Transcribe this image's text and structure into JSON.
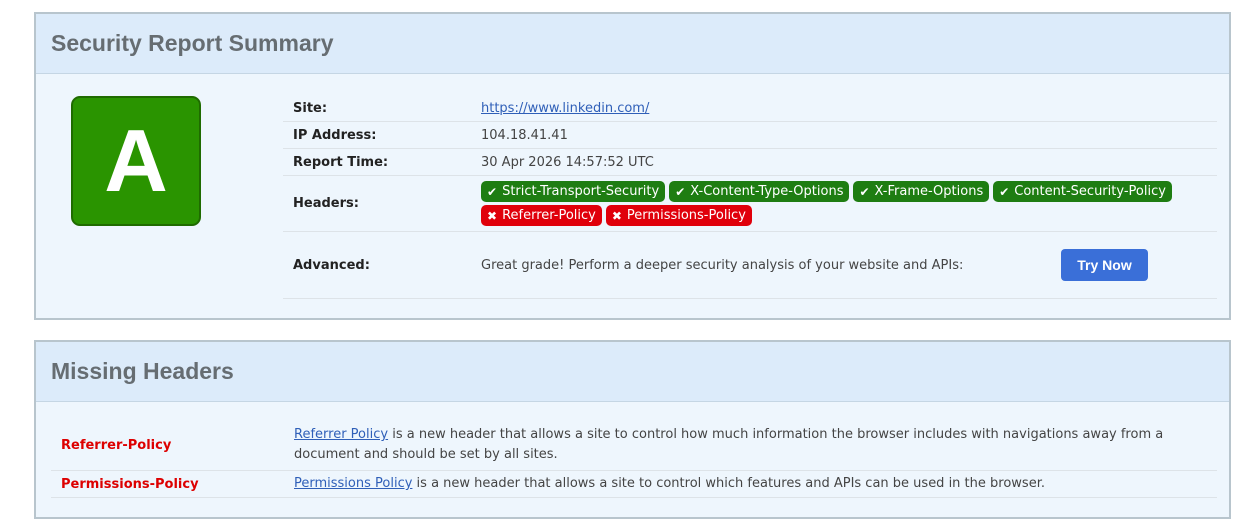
{
  "summary": {
    "title": "Security Report Summary",
    "grade": "A",
    "grade_color": "#2a9400",
    "site_label": "Site:",
    "site_url": "https://www.linkedin.com/",
    "ip_label": "IP Address:",
    "ip_value": "104.18.41.41",
    "time_label": "Report Time:",
    "time_value": "30 Apr 2026 14:57:52 UTC",
    "headers_label": "Headers:",
    "headers": [
      {
        "name": "Strict-Transport-Security",
        "status": "present",
        "icon": "check-icon"
      },
      {
        "name": "X-Content-Type-Options",
        "status": "present",
        "icon": "check-icon"
      },
      {
        "name": "X-Frame-Options",
        "status": "present",
        "icon": "check-icon"
      },
      {
        "name": "Content-Security-Policy",
        "status": "present",
        "icon": "check-icon"
      },
      {
        "name": "Referrer-Policy",
        "status": "missing",
        "icon": "cross-icon"
      },
      {
        "name": "Permissions-Policy",
        "status": "missing",
        "icon": "cross-icon"
      }
    ],
    "present_color": "#1e7d12",
    "missing_color": "#e0000b",
    "advanced_label": "Advanced:",
    "advanced_text": "Great grade! Perform a deeper security analysis of your website and APIs:",
    "try_button": "Try Now"
  },
  "missing": {
    "title": "Missing Headers",
    "items": [
      {
        "name": "Referrer-Policy",
        "link_text": "Referrer Policy",
        "description": " is a new header that allows a site to control how much information the browser includes with navigations away from a document and should be set by all sites."
      },
      {
        "name": "Permissions-Policy",
        "link_text": "Permissions Policy",
        "description": " is a new header that allows a site to control which features and APIs can be used in the browser."
      }
    ]
  }
}
